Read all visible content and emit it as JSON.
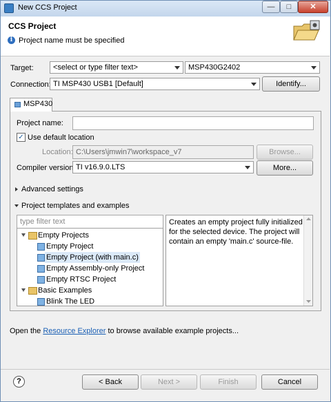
{
  "window": {
    "title": "New CCS Project",
    "close_glyph": "✕",
    "min_glyph": "—",
    "max_glyph": "□"
  },
  "header": {
    "title": "CCS Project",
    "message": "Project name must be specified",
    "message_icon": "i"
  },
  "form": {
    "target_label": "Target:",
    "target_filter_placeholder": "<select or type filter text>",
    "target_device": "MSP430G2402",
    "connection_label": "Connection:",
    "connection_value": "TI MSP430 USB1 [Default]",
    "identify_button": "Identify..."
  },
  "tab": {
    "label": "MSP430"
  },
  "project": {
    "name_label": "Project name:",
    "name_value": "",
    "use_default_label": "Use default location",
    "use_default_checked": true,
    "location_label": "Location:",
    "location_value": "C:\\Users\\jmwin7\\workspace_v7",
    "browse_button": "Browse...",
    "compiler_label": "Compiler version:",
    "compiler_value": "TI v16.9.0.LTS",
    "more_button": "More...",
    "advanced_label": "Advanced settings",
    "templates_label": "Project templates and examples",
    "filter_placeholder": "type filter text"
  },
  "tree": {
    "items": [
      {
        "label": "Empty Projects",
        "level": 0,
        "kind": "folder",
        "expanded": true
      },
      {
        "label": "Empty Project",
        "level": 1,
        "kind": "project"
      },
      {
        "label": "Empty Project (with main.c)",
        "level": 1,
        "kind": "project",
        "selected": true
      },
      {
        "label": "Empty Assembly-only Project",
        "level": 1,
        "kind": "project"
      },
      {
        "label": "Empty RTSC Project",
        "level": 1,
        "kind": "project"
      },
      {
        "label": "Basic Examples",
        "level": 0,
        "kind": "folder",
        "expanded": true
      },
      {
        "label": "Blink The LED",
        "level": 1,
        "kind": "project"
      }
    ]
  },
  "description": "Creates an empty project fully initialized for the selected device. The project will contain an empty 'main.c' source-file.",
  "footer_text": {
    "prefix": "Open the ",
    "link": "Resource Explorer",
    "suffix": " to browse available example projects..."
  },
  "buttons": {
    "help": "?",
    "back": "< Back",
    "next": "Next >",
    "finish": "Finish",
    "cancel": "Cancel"
  },
  "colors": {
    "accent": "#2f6fbf",
    "link": "#1a5fb4",
    "selection": "#dbe9f8"
  }
}
